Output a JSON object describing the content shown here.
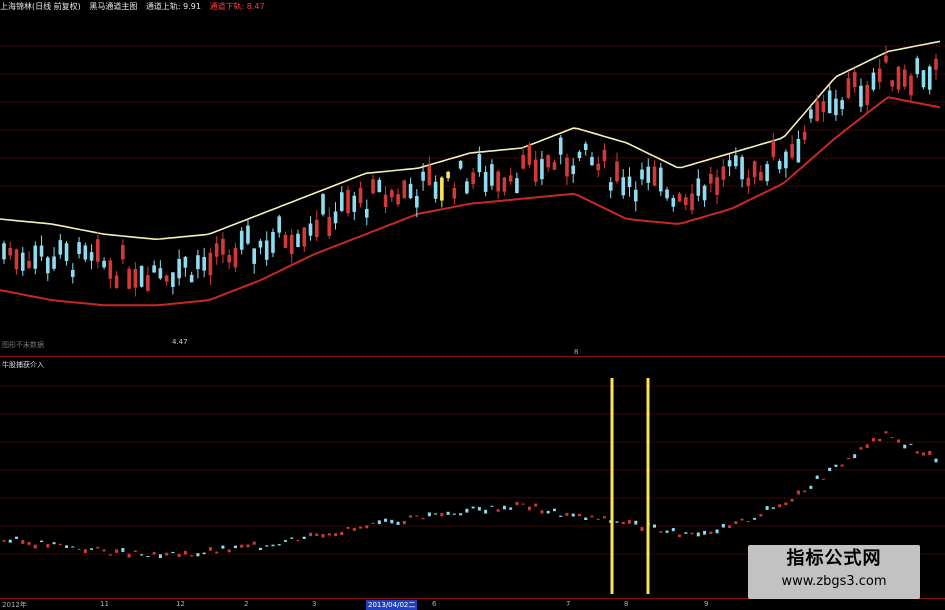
{
  "header": {
    "security": "上海锦林(日线 前复权)",
    "indicator": "黑马通道主图",
    "upper_label": "通道上轨: 9.91",
    "lower_label": "通道下轨: 8.47"
  },
  "main": {
    "low_label": "4.47",
    "note": "图形不未数据"
  },
  "sub": {
    "title": "牛股捕获介入"
  },
  "marker": "8",
  "axis": [
    "2012年",
    "11",
    "12",
    "2",
    "3",
    "2013/04/02二",
    "6",
    "7",
    "8",
    "9"
  ],
  "watermark": {
    "title": "指标公式网",
    "url": "www.zbgs3.com"
  },
  "colors": {
    "upper_band": "#f4f0b8",
    "lower_band": "#c82828",
    "candle_up": "#d23a3a",
    "candle_down": "#8fdcf0",
    "highlight_candle": "#f6e65a",
    "signal_line": "#f6e65a",
    "grid": "#8a1010"
  },
  "chart_data": [
    {
      "type": "line",
      "series": [
        {
          "values": [
            7.6,
            7.5,
            7.3,
            7.2,
            7.3,
            7.7,
            8.1,
            8.5,
            8.6,
            8.9,
            9.0,
            9.4,
            9.1,
            8.6,
            8.9,
            9.2,
            10.4,
            10.9,
            11.1
          ]
        },
        {
          "values": [
            6.2,
            6.0,
            5.9,
            5.9,
            6.0,
            6.4,
            6.9,
            7.3,
            7.7,
            7.9,
            8.0,
            8.1,
            7.6,
            7.5,
            7.8,
            8.3,
            9.2,
            10.0,
            9.8
          ]
        }
      ],
      "x": [
        "2012年",
        "11",
        "12",
        "2",
        "3",
        "2013/04/02二",
        "6",
        "7",
        "8",
        "9"
      ]
    },
    {
      "type": "line",
      "series": [
        {
          "values": [
            1.0,
            0.95,
            0.9,
            0.85,
            0.9,
            0.95,
            1.05,
            1.1,
            1.2,
            1.25,
            1.3,
            1.2,
            1.15,
            1.05,
            1.1,
            1.3,
            1.6,
            1.9,
            1.7
          ]
        }
      ]
    }
  ]
}
